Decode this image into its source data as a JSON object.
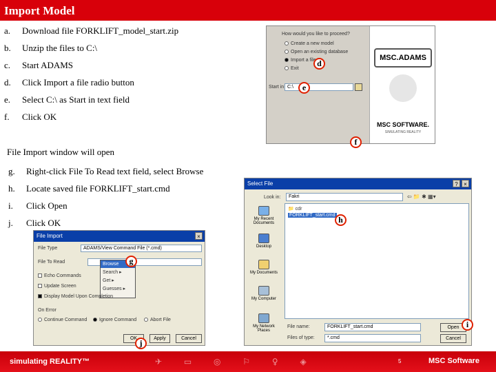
{
  "page": {
    "title": "Import Model"
  },
  "steps_top": [
    {
      "label": "a.",
      "text": "Download file FORKLIFT_model_start.zip"
    },
    {
      "label": "b.",
      "text": "Unzip the files to C:\\"
    },
    {
      "label": "c.",
      "text": "Start ADAMS"
    },
    {
      "label": "d.",
      "text": "Click Import a file radio button"
    },
    {
      "label": "e.",
      "text": "Select C:\\ as Start in text field"
    },
    {
      "label": "f.",
      "text": "Click OK"
    }
  ],
  "note": "File Import window will open",
  "steps_bottom": [
    {
      "label": "g.",
      "text": "Right-click File To Read text field, select Browse"
    },
    {
      "label": "h.",
      "text": "Locate saved file FORKLIFT_start.cmd"
    },
    {
      "label": "i.",
      "text": "Click Open"
    },
    {
      "label": "j.",
      "text": "Click OK"
    }
  ],
  "welcome": {
    "prompt": "How would you like to proceed?",
    "options": [
      "Create a new model",
      "Open an existing database",
      "Import a file",
      "Exit"
    ],
    "start_in_label": "Start in",
    "start_in_value": "C:\\",
    "logo_top": "MSC.ADAMS",
    "logo_bottom": "MSC SOFTWARE.",
    "logo_sub": "SIMULATING REALITY"
  },
  "select_file": {
    "title": "Select File",
    "look_in_label": "Look in:",
    "look_in_value": "Fakri",
    "files": [
      "cdr",
      "FORKLIFT_start.cmd"
    ],
    "places": [
      "My Recent Documents",
      "Desktop",
      "My Documents",
      "My Computer",
      "My Network Places"
    ],
    "file_name_label": "File name:",
    "file_name_value": "FORKLIFT_start.cmd",
    "file_type_label": "Files of type:",
    "file_type_value": "*.cmd",
    "open_label": "Open",
    "cancel_label": "Cancel"
  },
  "file_import": {
    "title": "File Import",
    "file_type_label": "File Type",
    "file_type_value": "ADAMS/View Command File (*.cmd)",
    "file_to_read_label": "File To Read",
    "context_menu": [
      "Browse",
      "Search",
      "Get",
      "Guesses"
    ],
    "options": [
      "Echo Commands",
      "Update Screen",
      "Display Model Upon Completion"
    ],
    "on_error_label": "On Error",
    "on_error_options": [
      "Continue Command",
      "Ignore Command",
      "Abort File"
    ],
    "ok_label": "OK",
    "apply_label": "Apply",
    "cancel_label": "Cancel"
  },
  "callouts": {
    "d": "d",
    "e": "e",
    "f": "f",
    "g": "g",
    "h": "h",
    "i": "i",
    "j": "j"
  },
  "footer": {
    "tagline": "simulating REALITY™",
    "page_number": "5",
    "brand": "MSC Software"
  }
}
